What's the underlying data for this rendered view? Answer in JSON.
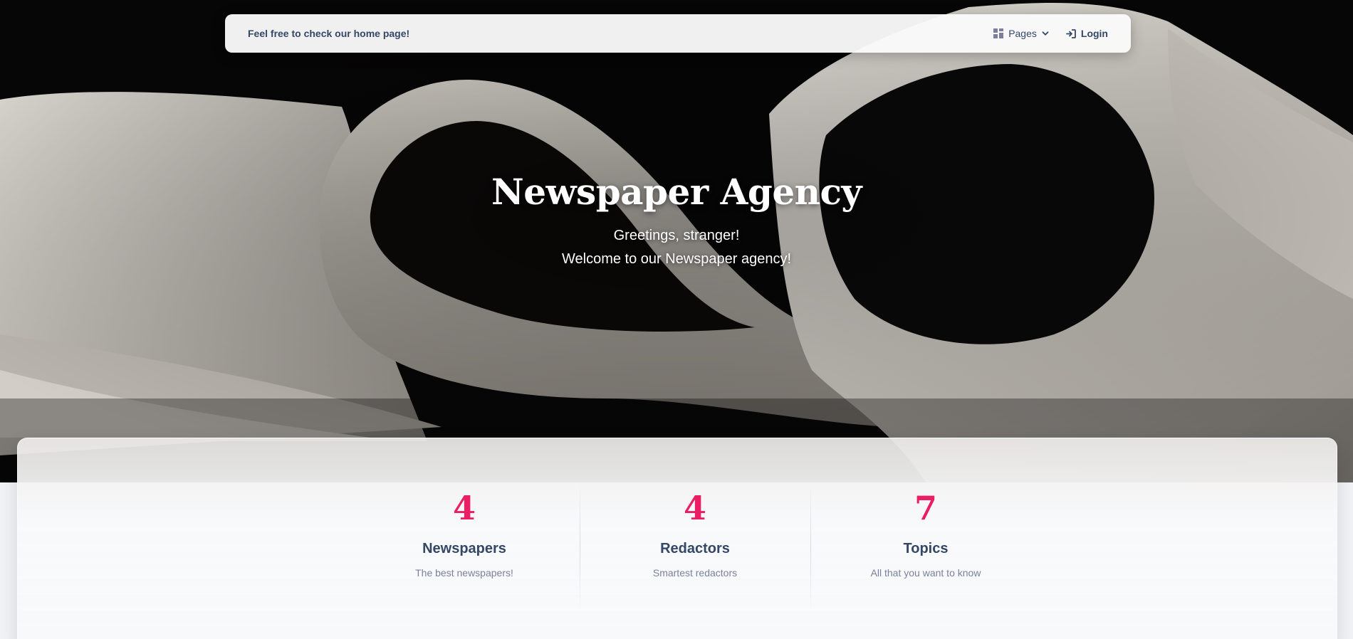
{
  "navbar": {
    "brand": "Feel free to check our home page!",
    "pages_label": "Pages",
    "login_label": "Login"
  },
  "hero": {
    "title": "Newspaper Agency",
    "line1": "Greetings, stranger!",
    "line2": "Welcome to our Newspaper agency!"
  },
  "stats": [
    {
      "number": "4",
      "title": "Newspapers",
      "description": "The best newspapers!"
    },
    {
      "number": "4",
      "title": "Redactors",
      "description": "Smartest redactors"
    },
    {
      "number": "7",
      "title": "Topics",
      "description": "All that you want to know"
    }
  ],
  "colors": {
    "accent": "#e91e63",
    "heading": "#344767",
    "muted": "#7b809a"
  },
  "icons": [
    "dashboard-icon",
    "chevron-down-icon",
    "login-icon"
  ]
}
